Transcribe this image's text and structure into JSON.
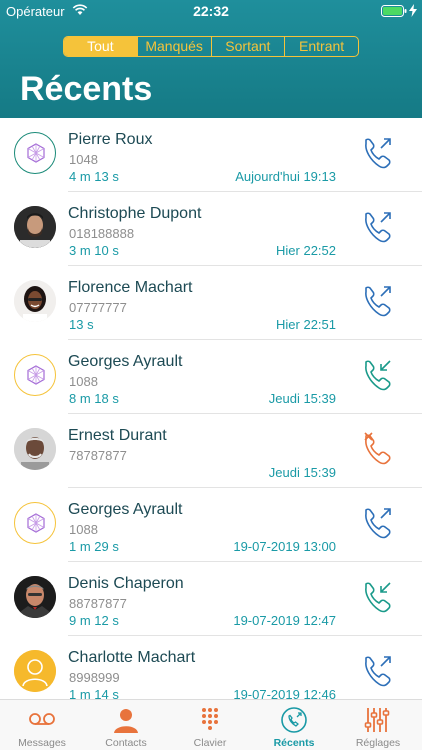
{
  "status": {
    "carrier": "Opérateur",
    "time": "22:32"
  },
  "filter": {
    "segments": [
      "Tout",
      "Manqués",
      "Sortant",
      "Entrant"
    ],
    "selected": "Tout"
  },
  "page": {
    "title": "Récents"
  },
  "calls": [
    {
      "name": "Pierre Roux",
      "number": "1048",
      "duration": "4 m  13 s",
      "date": "Aujourd'hui  19:13",
      "type": "outgoing",
      "avatar": "logo-green"
    },
    {
      "name": "Christophe Dupont",
      "number": "018188888",
      "duration": "3 m 10 s",
      "date": "Hier  22:52",
      "type": "outgoing",
      "avatar": "photo"
    },
    {
      "name": "Florence Machart",
      "number": "07777777",
      "duration": "13 s",
      "date": "Hier  22:51",
      "type": "outgoing",
      "avatar": "photo"
    },
    {
      "name": "Georges Ayrault",
      "number": "1088",
      "duration": "8 m  18 s",
      "date": "Jeudi  15:39",
      "type": "incoming",
      "avatar": "logo-yellow"
    },
    {
      "name": "Ernest Durant",
      "number": "78787877",
      "duration": "",
      "date": "Jeudi  15:39",
      "type": "missed",
      "avatar": "photo"
    },
    {
      "name": "Georges Ayrault",
      "number": "1088",
      "duration": "1 m  29 s",
      "date": "19-07-2019  13:00",
      "type": "outgoing",
      "avatar": "logo-yellow"
    },
    {
      "name": "Denis Chaperon",
      "number": "88787877",
      "duration": "9 m  12 s",
      "date": "19-07-2019  12:47",
      "type": "incoming",
      "avatar": "photo"
    },
    {
      "name": "Charlotte Machart",
      "number": "8998999",
      "duration": "1 m  14 s",
      "date": "19-07-2019  12:46",
      "type": "outgoing",
      "avatar": "placeholder"
    }
  ],
  "tabs": [
    {
      "label": "Messages",
      "icon": "voicemail-icon"
    },
    {
      "label": "Contacts",
      "icon": "contacts-icon"
    },
    {
      "label": "Clavier",
      "icon": "keypad-icon"
    },
    {
      "label": "Récents",
      "icon": "recents-icon",
      "active": true
    },
    {
      "label": "Réglages",
      "icon": "settings-icon"
    }
  ],
  "colors": {
    "header": "#1f8f9c",
    "accent": "#f5c33a",
    "teal": "#1a9aa6",
    "outgoing": "#2d6fb8",
    "incoming": "#1a9a8a",
    "missed": "#e8733c"
  }
}
